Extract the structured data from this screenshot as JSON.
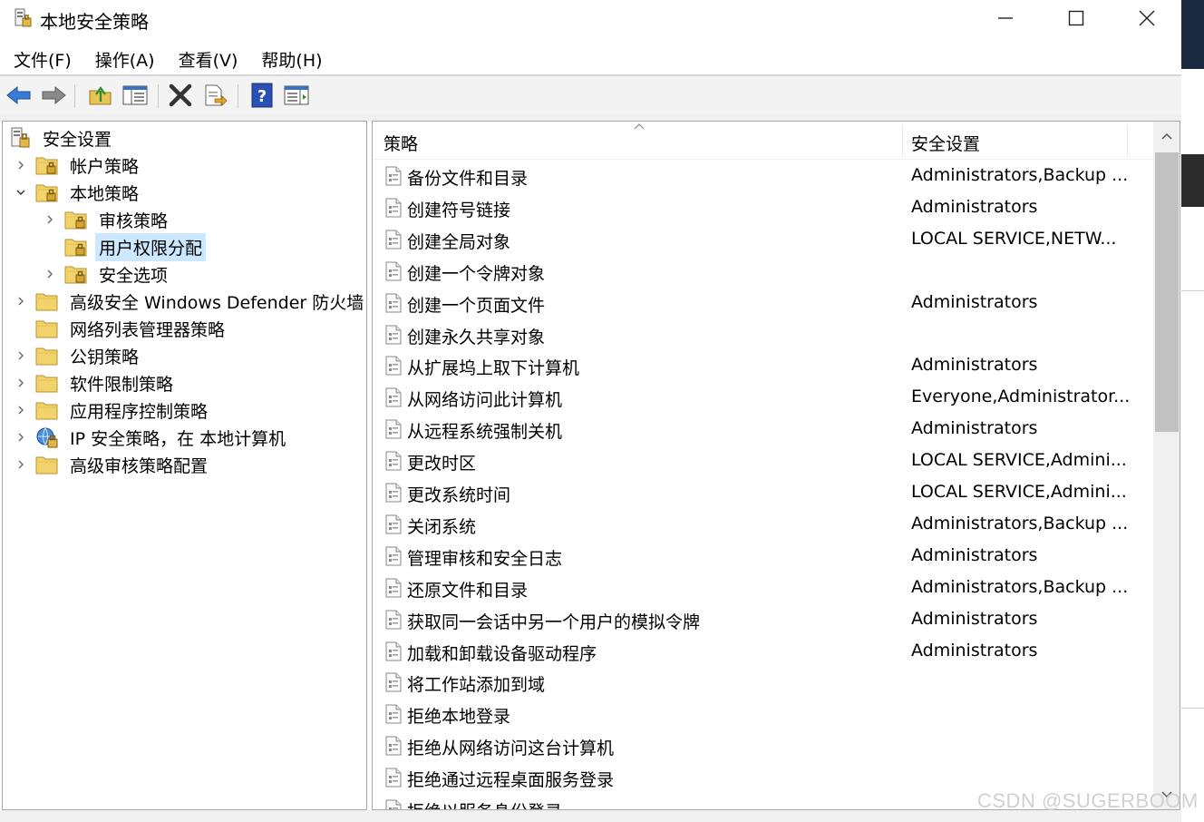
{
  "window": {
    "title": "本地安全策略",
    "controls": {
      "minimize": "minimize-icon",
      "maximize": "maximize-icon",
      "close": "close-icon"
    }
  },
  "menu": [
    "文件(F)",
    "操作(A)",
    "查看(V)",
    "帮助(H)"
  ],
  "toolbar": [
    "back-icon",
    "forward-icon",
    "up-folder-icon",
    "show-hide-tree-icon",
    "delete-icon",
    "export-list-icon",
    "help-icon",
    "properties-view-icon"
  ],
  "tree": [
    {
      "label": "安全设置",
      "level": 0,
      "expander": "none",
      "icon": "security-settings-icon"
    },
    {
      "label": "帐户策略",
      "level": 1,
      "expander": "collapsed",
      "icon": "locked-folder-icon"
    },
    {
      "label": "本地策略",
      "level": 1,
      "expander": "expanded",
      "icon": "locked-folder-icon"
    },
    {
      "label": "审核策略",
      "level": 2,
      "expander": "collapsed",
      "icon": "locked-folder-icon"
    },
    {
      "label": "用户权限分配",
      "level": 2,
      "expander": "none",
      "icon": "locked-folder-icon",
      "selected": true
    },
    {
      "label": "安全选项",
      "level": 2,
      "expander": "collapsed",
      "icon": "locked-folder-icon"
    },
    {
      "label": "高级安全 Windows Defender 防火墙",
      "level": 1,
      "expander": "collapsed",
      "icon": "folder-icon"
    },
    {
      "label": "网络列表管理器策略",
      "level": 1,
      "expander": "none",
      "icon": "folder-icon"
    },
    {
      "label": "公钥策略",
      "level": 1,
      "expander": "collapsed",
      "icon": "folder-icon"
    },
    {
      "label": "软件限制策略",
      "level": 1,
      "expander": "collapsed",
      "icon": "folder-icon"
    },
    {
      "label": "应用程序控制策略",
      "level": 1,
      "expander": "collapsed",
      "icon": "folder-icon"
    },
    {
      "label": "IP 安全策略，在 本地计算机",
      "level": 1,
      "expander": "collapsed",
      "icon": "ip-security-icon"
    },
    {
      "label": "高级审核策略配置",
      "level": 1,
      "expander": "collapsed",
      "icon": "folder-icon"
    }
  ],
  "list": {
    "columns": [
      "策略",
      "安全设置"
    ],
    "rows": [
      {
        "policy": "备份文件和目录",
        "setting": "Administrators,Backup ..."
      },
      {
        "policy": "创建符号链接",
        "setting": "Administrators"
      },
      {
        "policy": "创建全局对象",
        "setting": "LOCAL SERVICE,NETW..."
      },
      {
        "policy": "创建一个令牌对象",
        "setting": ""
      },
      {
        "policy": "创建一个页面文件",
        "setting": "Administrators"
      },
      {
        "policy": "创建永久共享对象",
        "setting": ""
      },
      {
        "policy": "从扩展坞上取下计算机",
        "setting": "Administrators"
      },
      {
        "policy": "从网络访问此计算机",
        "setting": "Everyone,Administrator..."
      },
      {
        "policy": "从远程系统强制关机",
        "setting": "Administrators"
      },
      {
        "policy": "更改时区",
        "setting": "LOCAL SERVICE,Admini..."
      },
      {
        "policy": "更改系统时间",
        "setting": "LOCAL SERVICE,Admini..."
      },
      {
        "policy": "关闭系统",
        "setting": "Administrators,Backup ..."
      },
      {
        "policy": "管理审核和安全日志",
        "setting": "Administrators"
      },
      {
        "policy": "还原文件和目录",
        "setting": "Administrators,Backup ..."
      },
      {
        "policy": "获取同一会话中另一个用户的模拟令牌",
        "setting": "Administrators"
      },
      {
        "policy": "加载和卸载设备驱动程序",
        "setting": "Administrators"
      },
      {
        "policy": "将工作站添加到域",
        "setting": ""
      },
      {
        "policy": "拒绝本地登录",
        "setting": ""
      },
      {
        "policy": "拒绝从网络访问这台计算机",
        "setting": ""
      },
      {
        "policy": "拒绝通过远程桌面服务登录",
        "setting": ""
      },
      {
        "policy": "拒绝以服务身份登录",
        "setting": ""
      }
    ]
  },
  "watermark": "CSDN @SUGERBOOM",
  "colors": {
    "selection": "#cce8ff",
    "help": "#2a4fb5",
    "arrow": "#3a7bd5",
    "delete": "#333333"
  }
}
